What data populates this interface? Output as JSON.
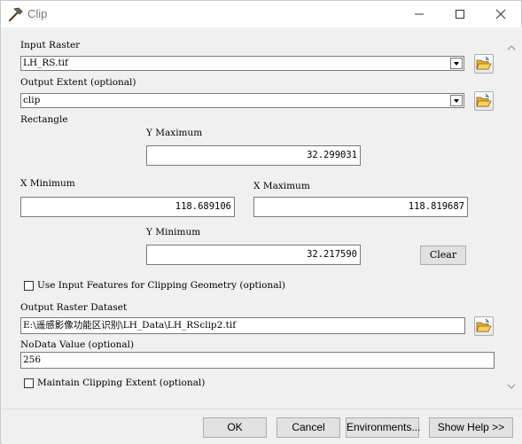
{
  "window": {
    "title": "Clip"
  },
  "fields": {
    "input_raster": {
      "label": "Input Raster",
      "value": "LH_RS.tif"
    },
    "output_extent": {
      "label": "Output Extent (optional)",
      "value": "clip"
    },
    "rectangle": {
      "label": "Rectangle",
      "y_max_label": "Y Maximum",
      "y_max": "32.299031",
      "x_min_label": "X Minimum",
      "x_min": "118.689106",
      "x_max_label": "X Maximum",
      "x_max": "118.819687",
      "y_min_label": "Y Minimum",
      "y_min": "32.217590",
      "clear_label": "Clear"
    },
    "use_input_features": {
      "label": "Use Input Features for Clipping Geometry (optional)",
      "checked": false
    },
    "output_raster": {
      "label": "Output Raster Dataset",
      "value": "E:\\遥感影像功能区识别\\LH_Data\\LH_RSclip2.tif"
    },
    "nodata": {
      "label": "NoData Value (optional)",
      "value": "256"
    },
    "maintain_extent": {
      "label": "Maintain Clipping Extent (optional)",
      "checked": false
    }
  },
  "buttons": {
    "ok": "OK",
    "cancel": "Cancel",
    "environments": "Environments...",
    "show_help": "Show Help >>"
  },
  "icons": {
    "app": "hammer-icon",
    "minimize": "minimize-icon",
    "maximize": "maximize-icon",
    "close": "close-icon",
    "browse": "folder-open-icon"
  }
}
